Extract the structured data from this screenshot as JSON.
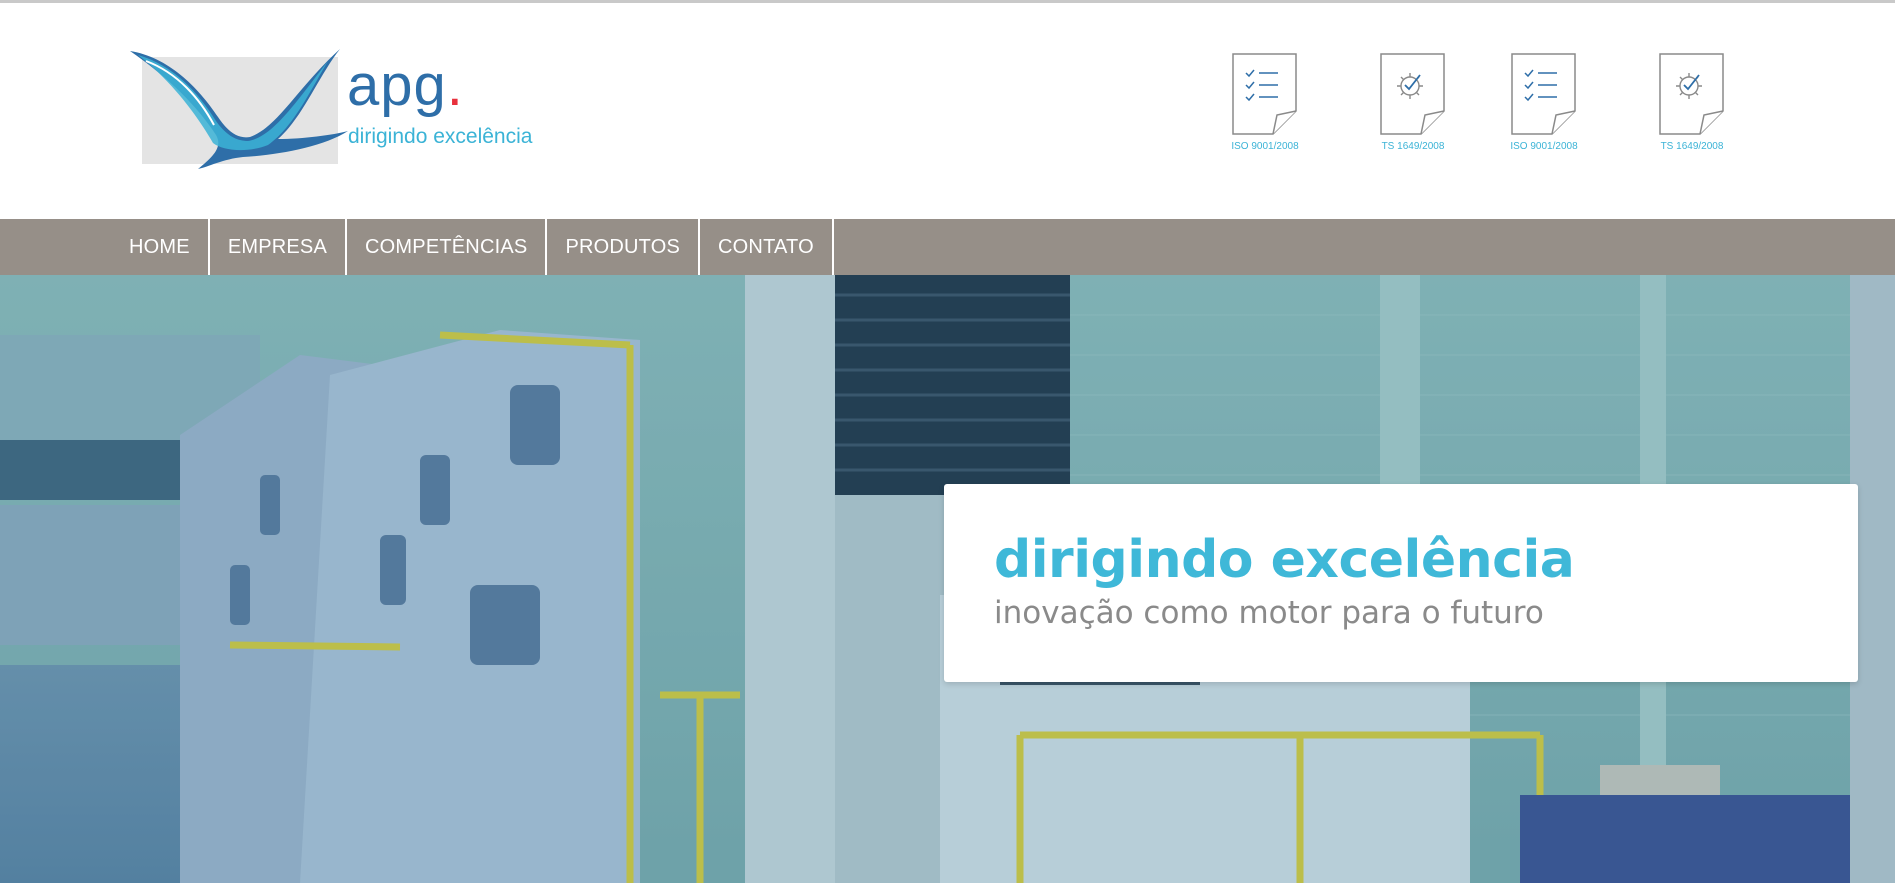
{
  "brand": {
    "wordmark": "apg",
    "wordmark_dot": ".",
    "tagline": "dirigindo excelência",
    "colors": {
      "blue": "#2e6ea8",
      "cyan": "#3bb3d6",
      "red": "#e8303c"
    }
  },
  "certifications": [
    {
      "label": "ISO 9001/2008",
      "icon": "checklist-document-icon"
    },
    {
      "label": "TS 1649/2008",
      "icon": "gear-check-document-icon"
    },
    {
      "label": "ISO 9001/2008",
      "icon": "checklist-document-icon"
    },
    {
      "label": "TS 1649/2008",
      "icon": "gear-check-document-icon"
    }
  ],
  "nav": {
    "items": [
      "HOME",
      "EMPRESA",
      "COMPETÊNCIAS",
      "PRODUTOS",
      "CONTATO"
    ],
    "background": "#968f88"
  },
  "hero": {
    "title": "dirigindo excelência",
    "subtitle": "inovação como motor para o futuro",
    "title_color": "#3fb8d8"
  }
}
